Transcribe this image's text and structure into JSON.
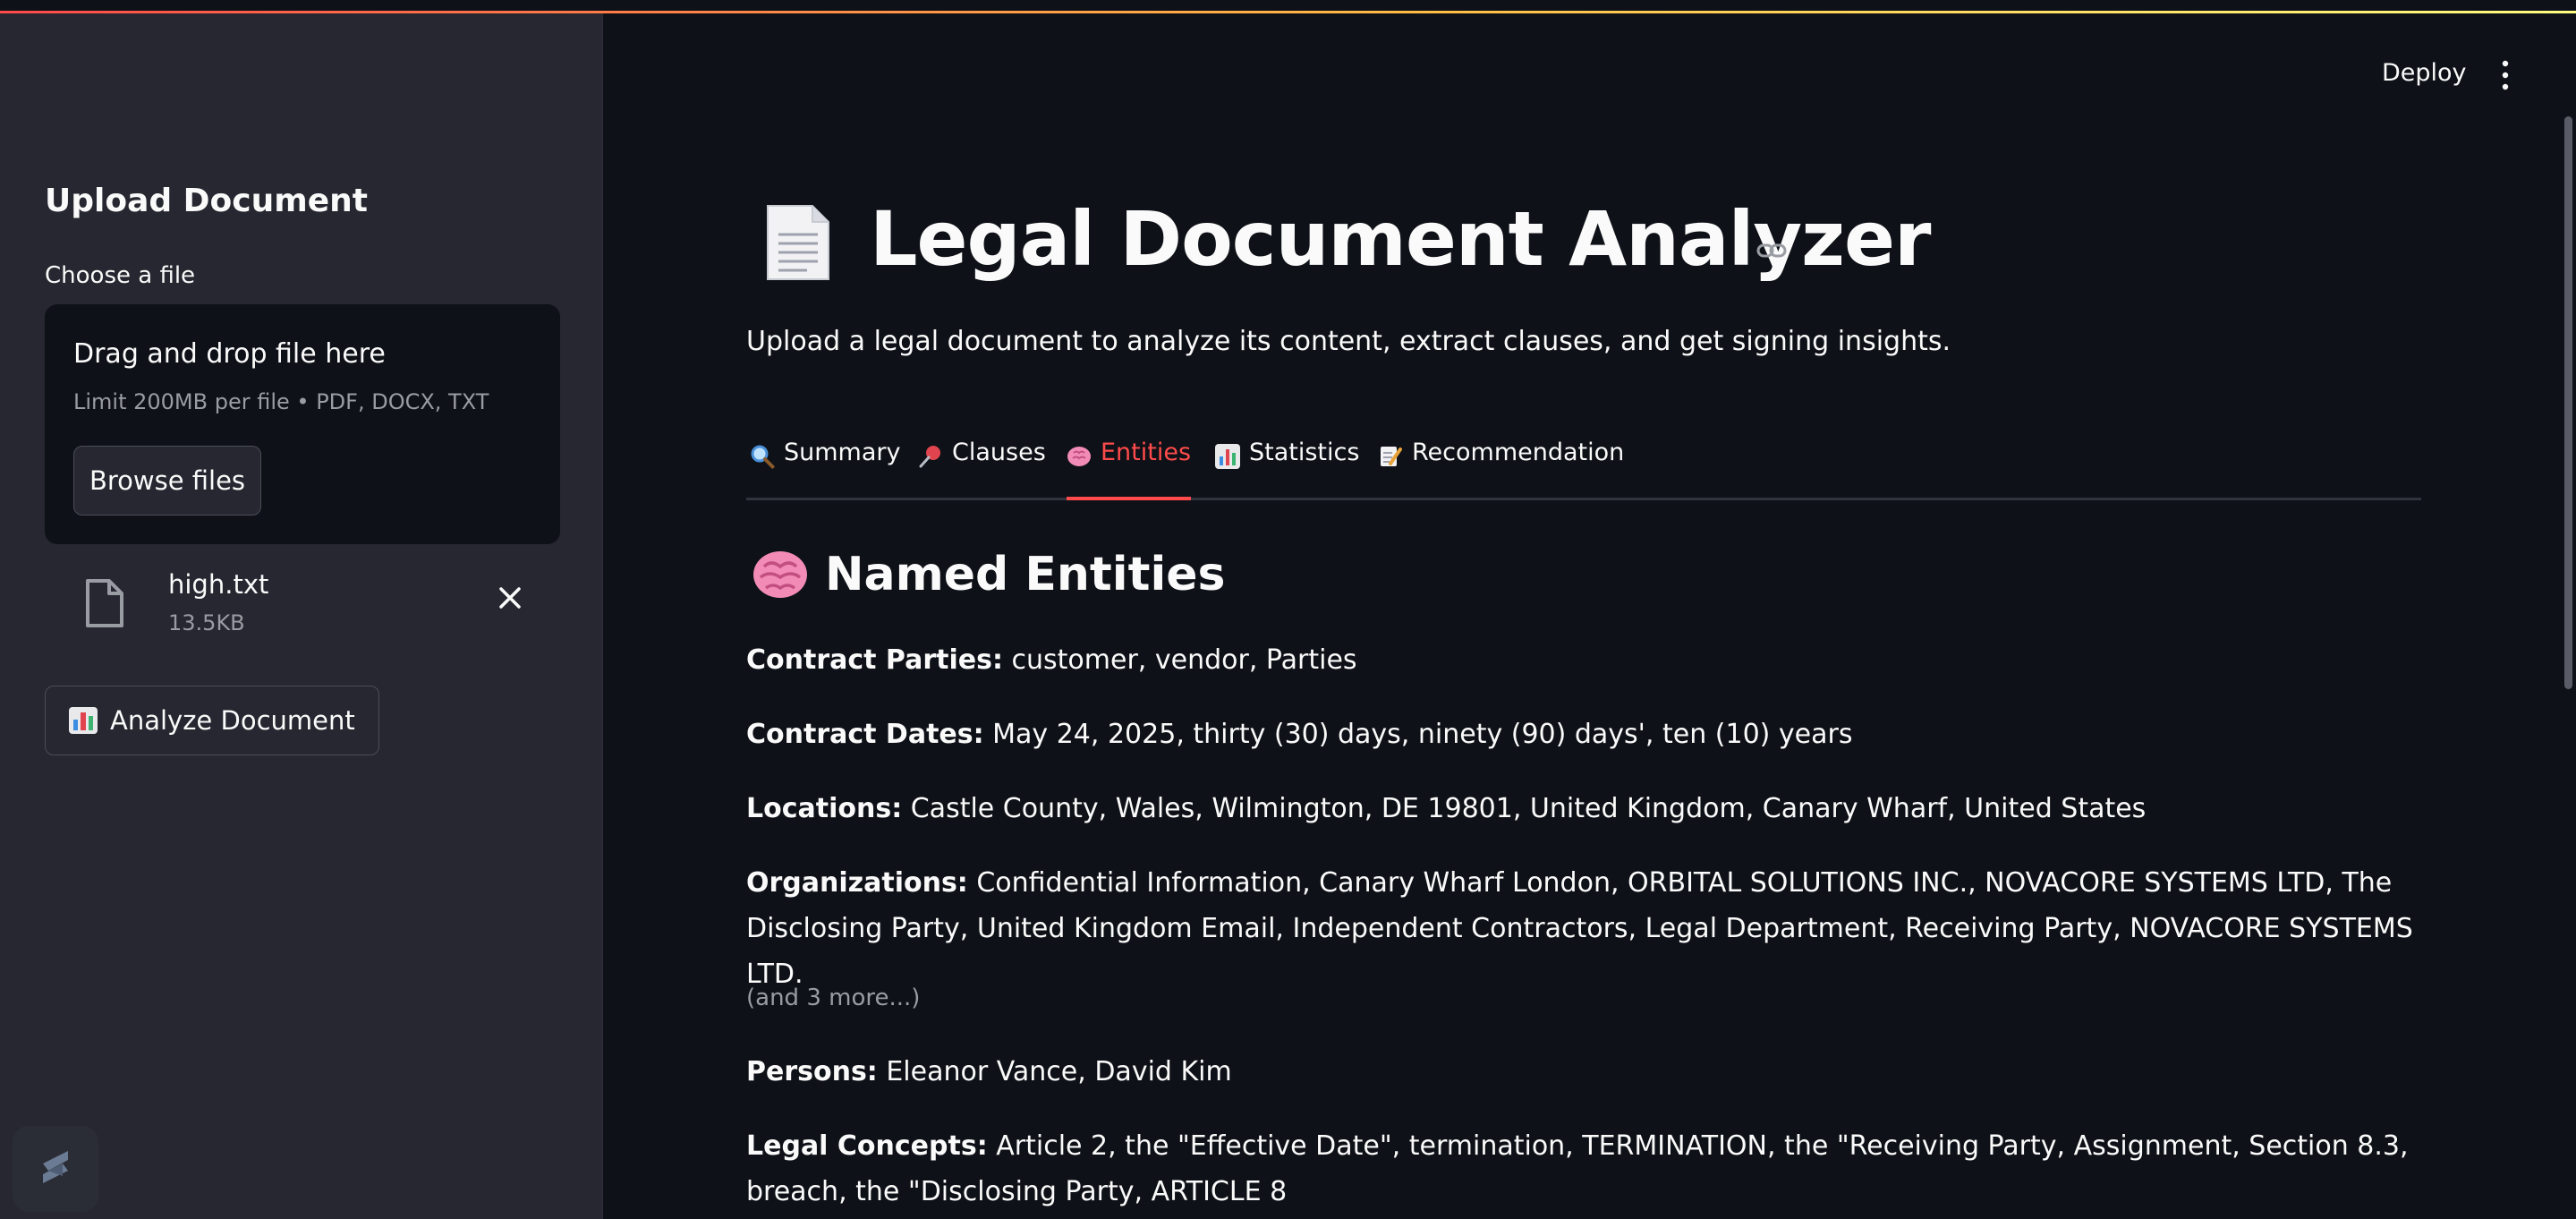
{
  "sidebar": {
    "title": "Upload Document",
    "file_label": "Choose a file",
    "dropzone": {
      "title": "Drag and drop file here",
      "limit": "Limit 200MB per file • PDF, DOCX, TXT",
      "browse_label": "Browse files"
    },
    "uploaded_file": {
      "name": "high.txt",
      "size": "13.5KB"
    },
    "analyze_label": "Analyze Document"
  },
  "header": {
    "deploy_label": "Deploy"
  },
  "main": {
    "title": "Legal Document Analyzer",
    "subtitle": "Upload a legal document to analyze its content, extract clauses, and get signing insights.",
    "tabs": [
      {
        "label": "Summary",
        "icon": "magnifier-icon"
      },
      {
        "label": "Clauses",
        "icon": "pushpin-icon"
      },
      {
        "label": "Entities",
        "icon": "brain-icon",
        "active": true
      },
      {
        "label": "Statistics",
        "icon": "bar-chart-icon"
      },
      {
        "label": "Recommendation",
        "icon": "memo-icon"
      }
    ],
    "section_title": "Named Entities",
    "entities": [
      {
        "label": "Contract Parties:",
        "value": " customer, vendor, Parties"
      },
      {
        "label": "Contract Dates:",
        "value": " May 24, 2025, thirty (30) days, ninety (90) days', ten (10) years"
      },
      {
        "label": "Locations:",
        "value": " Castle County, Wales, Wilmington, DE 19801, United Kingdom, Canary Wharf, United States"
      },
      {
        "label": "Organizations:",
        "value": " Confidential Information, Canary Wharf London, ORBITAL SOLUTIONS INC., NOVACORE SYSTEMS LTD, The Disclosing Party, United Kingdom Email, Independent Contractors, Legal Department, Receiving Party, NOVACORE SYSTEMS LTD."
      },
      {
        "label": "Persons:",
        "value": " Eleanor Vance, David Kim"
      },
      {
        "label": "Legal Concepts:",
        "value": " Article 2, the \"Effective Date\", termination, TERMINATION, the \"Receiving Party, Assignment, Section 8.3, breach, the \"Disclosing Party, ARTICLE 8"
      }
    ],
    "more_note": "(and 3 more...)"
  },
  "colors": {
    "accent": "#ff4b4b",
    "sidebar_bg": "#262730",
    "main_bg": "#0e1117"
  }
}
